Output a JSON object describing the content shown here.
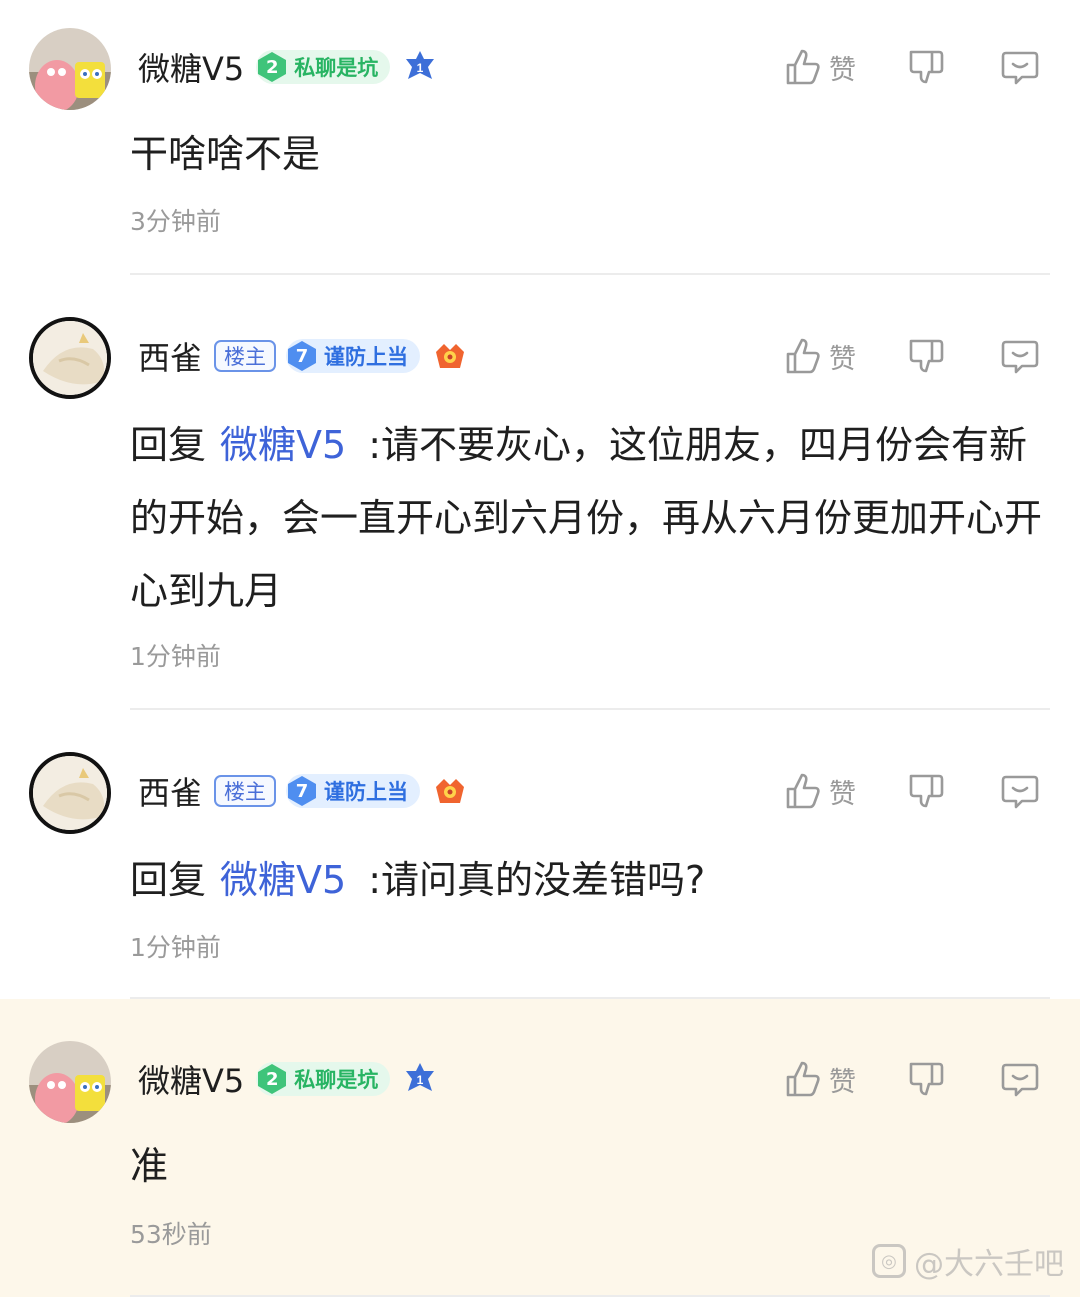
{
  "comments": [
    {
      "user": "微糖V5",
      "level": "2",
      "level_title": "私聊是坑",
      "rank_badge": "1",
      "like_label": "赞",
      "text": "干啥啥不是",
      "time": "3分钟前"
    },
    {
      "user": "西雀",
      "owner_tag": "楼主",
      "level": "7",
      "level_title": "谨防上当",
      "reply_prefix": "回复",
      "mention": "微糖V5",
      "like_label": "赞",
      "text": ":请不要灰心，这位朋友，四月份会有新的开始，会一直开心到六月份，再从六月份更加开心开心到九月",
      "time": "1分钟前"
    },
    {
      "user": "西雀",
      "owner_tag": "楼主",
      "level": "7",
      "level_title": "谨防上当",
      "reply_prefix": "回复",
      "mention": "微糖V5",
      "like_label": "赞",
      "text": ":请问真的没差错吗?",
      "time": "1分钟前"
    },
    {
      "user": "微糖V5",
      "level": "2",
      "level_title": "私聊是坑",
      "rank_badge": "1",
      "like_label": "赞",
      "text": "准",
      "time": "53秒前"
    }
  ],
  "watermark": "@大六壬吧",
  "colors": {
    "mention": "#3e63d8",
    "highlight_bg": "#fdf7ea",
    "level_green": "#28b463",
    "level_blue": "#2f6fe0"
  },
  "icons": [
    "thumbs-up-icon",
    "thumbs-down-icon",
    "reply-bubble-icon",
    "level-gem-icon",
    "rank-badge-icon",
    "fire-badge-icon"
  ]
}
